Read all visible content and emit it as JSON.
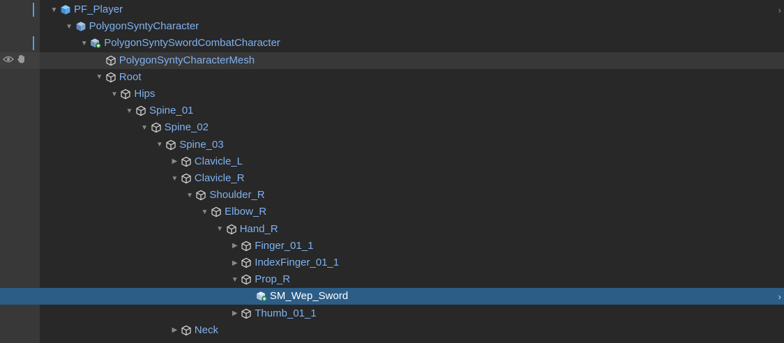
{
  "hierarchy": {
    "items": [
      {
        "label": "PF_Player",
        "expand": "expanded",
        "icon": "prefab-root-icon",
        "level": 0,
        "marker": true,
        "chevron": true
      },
      {
        "label": "PolygonSyntyCharacter",
        "expand": "expanded",
        "icon": "prefab-icon",
        "level": 1
      },
      {
        "label": "PolygonSyntySwordCombatCharacter",
        "expand": "expanded",
        "icon": "prefab-variant-icon",
        "level": 2,
        "marker": true
      },
      {
        "label": "PolygonSyntyCharacterMesh",
        "expand": "none",
        "icon": "gameobject-icon",
        "level": 3,
        "hover": true,
        "toggles": true
      },
      {
        "label": "Root",
        "expand": "expanded",
        "icon": "gameobject-icon",
        "level": 3
      },
      {
        "label": "Hips",
        "expand": "expanded",
        "icon": "gameobject-icon",
        "level": 4
      },
      {
        "label": "Spine_01",
        "expand": "expanded",
        "icon": "gameobject-icon",
        "level": 5
      },
      {
        "label": "Spine_02",
        "expand": "expanded",
        "icon": "gameobject-icon",
        "level": 6
      },
      {
        "label": "Spine_03",
        "expand": "expanded",
        "icon": "gameobject-icon",
        "level": 7
      },
      {
        "label": "Clavicle_L",
        "expand": "collapsed",
        "icon": "gameobject-icon",
        "level": 8
      },
      {
        "label": "Clavicle_R",
        "expand": "expanded",
        "icon": "gameobject-icon",
        "level": 8
      },
      {
        "label": "Shoulder_R",
        "expand": "expanded",
        "icon": "gameobject-icon",
        "level": 9
      },
      {
        "label": "Elbow_R",
        "expand": "expanded",
        "icon": "gameobject-icon",
        "level": 10
      },
      {
        "label": "Hand_R",
        "expand": "expanded",
        "icon": "gameobject-icon",
        "level": 11
      },
      {
        "label": "Finger_01_1",
        "expand": "collapsed",
        "icon": "gameobject-icon",
        "level": 12
      },
      {
        "label": "IndexFinger_01_1",
        "expand": "collapsed",
        "icon": "gameobject-icon",
        "level": 12
      },
      {
        "label": "Prop_R",
        "expand": "expanded",
        "icon": "gameobject-icon",
        "level": 12
      },
      {
        "label": "SM_Wep_Sword",
        "expand": "none",
        "icon": "prefab-added-icon",
        "level": 13,
        "selected": true,
        "chevron": true
      },
      {
        "label": "Thumb_01_1",
        "expand": "collapsed",
        "icon": "gameobject-icon",
        "level": 12
      },
      {
        "label": "Neck",
        "expand": "collapsed",
        "icon": "gameobject-icon",
        "level": 8
      }
    ]
  },
  "glyphs": {
    "expanded": "▼",
    "collapsed": "▶",
    "chevron": "›"
  },
  "colors": {
    "background": "#282828",
    "gutter": "#383838",
    "label": "#7fb2f0",
    "selected_row": "#2c5d87",
    "selected_label": "#ffffff",
    "prefab_marker": "#4aa3e6"
  }
}
